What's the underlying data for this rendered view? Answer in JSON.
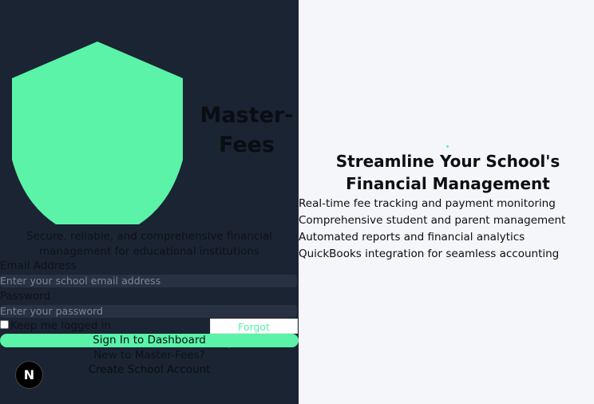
{
  "brand": {
    "name": "Master-Fees",
    "accent_color": "#5af3a8",
    "panel_color": "#1b2433"
  },
  "left": {
    "subtitle": "Secure, reliable, and comprehensive financial management for educational institutions",
    "email": {
      "label": "Email Address",
      "placeholder": "Enter your school email address"
    },
    "password": {
      "label": "Password",
      "placeholder": "Enter your password"
    },
    "remember_label": "Keep me logged in",
    "forgot_label": "Forgot password?",
    "signin_label": "Sign In to Dashboard",
    "new_to_label": "New to Master-Fees?",
    "create_label": "Create School Account",
    "badge_letter": "N"
  },
  "right": {
    "headline": "Streamline Your School's Financial Management",
    "features": [
      "Real-time fee tracking and payment monitoring",
      "Comprehensive student and parent management",
      "Automated reports and financial analytics",
      "QuickBooks integration for seamless accounting"
    ]
  }
}
